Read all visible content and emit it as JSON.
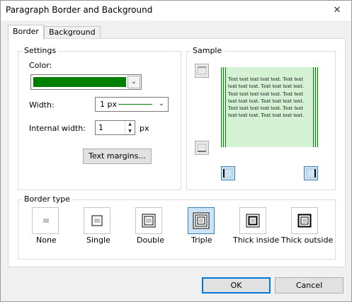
{
  "window": {
    "title": "Paragraph Border and Background",
    "close_glyph": "✕"
  },
  "tabs": [
    {
      "label": "Border",
      "active": true
    },
    {
      "label": "Background",
      "active": false
    }
  ],
  "settings": {
    "group_label": "Settings",
    "color_label": "Color:",
    "color_value": "#008000",
    "width_label": "Width:",
    "width_value": "1 px",
    "internal_width_label": "Internal width:",
    "internal_width_value": "1",
    "internal_width_unit": "px",
    "text_margins_button": "Text margins..."
  },
  "sample": {
    "group_label": "Sample",
    "text": "Text text text text text. Text text text text text. Text text text text.\nText text text text text. Text text text text text. Text text text text.\nText text text text text. Text text text text text. Text text text text."
  },
  "border_type": {
    "group_label": "Border type",
    "options": [
      {
        "label": "None",
        "selected": false
      },
      {
        "label": "Single",
        "selected": false
      },
      {
        "label": "Double",
        "selected": false
      },
      {
        "label": "Triple",
        "selected": true
      },
      {
        "label": "Thick inside",
        "selected": false
      },
      {
        "label": "Thick outside",
        "selected": false
      }
    ]
  },
  "buttons": {
    "ok": "OK",
    "cancel": "Cancel"
  }
}
